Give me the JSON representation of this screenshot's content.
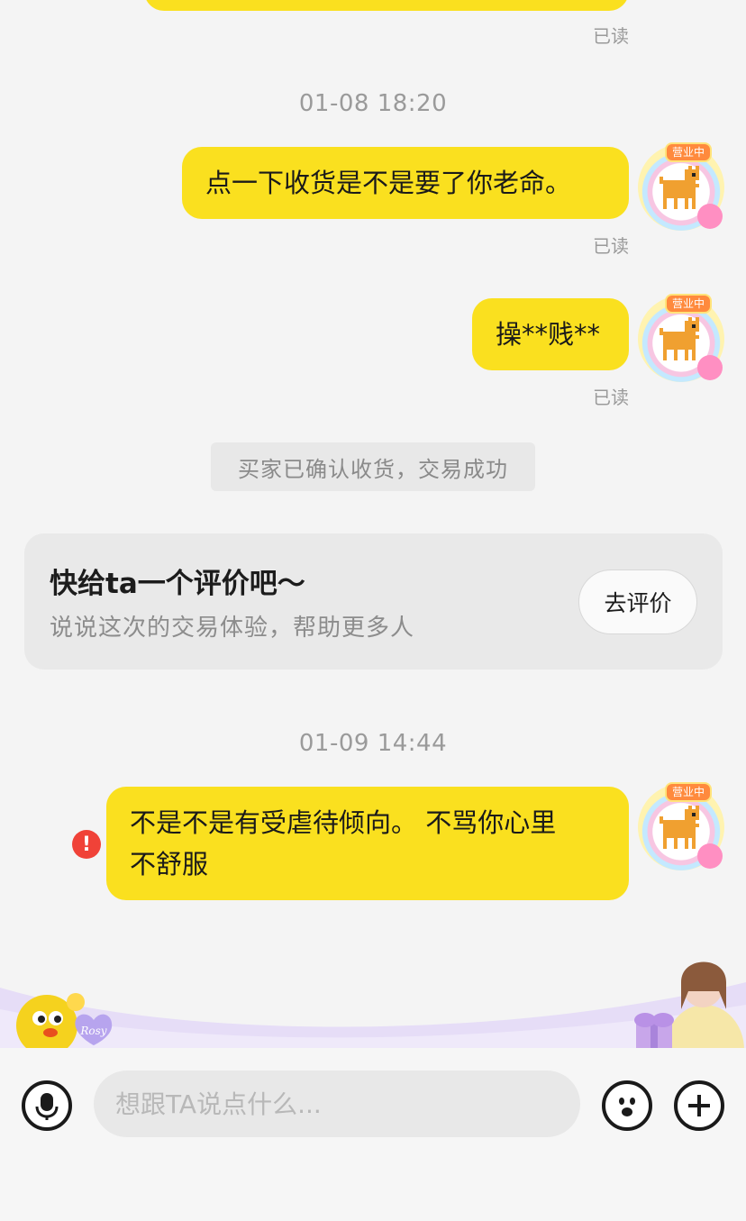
{
  "chat": {
    "top_read_status": "已读",
    "timestamps": [
      "01-08 18:20",
      "01-09 14:44"
    ],
    "messages": [
      {
        "text": "点一下收货是不是要了你老命。",
        "status": "已读"
      },
      {
        "text": "操**贱**",
        "status": "已读"
      },
      {
        "text_line1": "不是不是有受虐待倾向。 不骂你心里",
        "text_line2": "不舒服",
        "status": "failed"
      }
    ],
    "system_notice": "买家已确认收货，交易成功",
    "avatar_tag": "营业中"
  },
  "review_card": {
    "title": "快给ta一个评价吧～",
    "subtitle": "说说这次的交易体验，帮助更多人",
    "button": "去评价"
  },
  "banner": {
    "mascot_badge": "Rosy"
  },
  "input_bar": {
    "placeholder": "想跟TA说点什么..."
  },
  "colors": {
    "bubble": "#fae01f",
    "background": "#f4f4f4",
    "error": "#f04238"
  }
}
